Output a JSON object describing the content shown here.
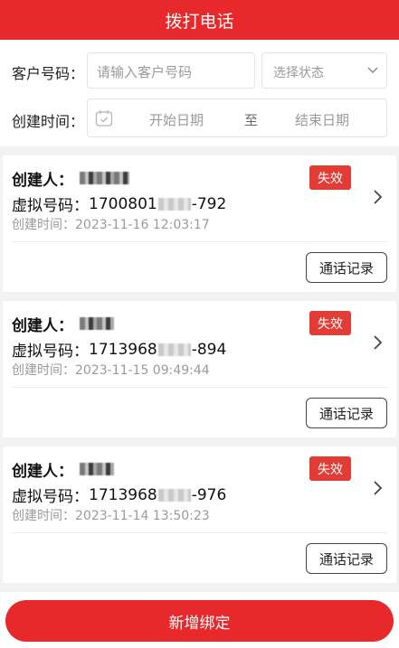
{
  "header": {
    "title": "拨打电话"
  },
  "filters": {
    "customer_label": "客户号码：",
    "customer_placeholder": "请输入客户号码",
    "status_placeholder": "选择状态",
    "time_label": "创建时间：",
    "start_placeholder": "开始日期",
    "range_separator": "至",
    "end_placeholder": "结束日期"
  },
  "records": [
    {
      "creator_label": "创建人：",
      "status": "失效",
      "number_label": "虚拟号码：",
      "number_prefix": "1700801",
      "number_suffix": "-792",
      "created": "创建时间：2023-11-16 12:03:17",
      "call_log_label": "通话记录"
    },
    {
      "creator_label": "创建人：",
      "status": "失效",
      "number_label": "虚拟号码：",
      "number_prefix": "1713968",
      "number_suffix": "-894",
      "created": "创建时间：2023-11-15 09:49:44",
      "call_log_label": "通话记录"
    },
    {
      "creator_label": "创建人：",
      "status": "失效",
      "number_label": "虚拟号码：",
      "number_prefix": "1713968",
      "number_suffix": "-976",
      "created": "创建时间：2023-11-14 13:50:23",
      "call_log_label": "通话记录"
    }
  ],
  "footer": {
    "add_label": "新增绑定"
  },
  "colors": {
    "brand": "#e7292c",
    "badge": "#e33c35"
  }
}
